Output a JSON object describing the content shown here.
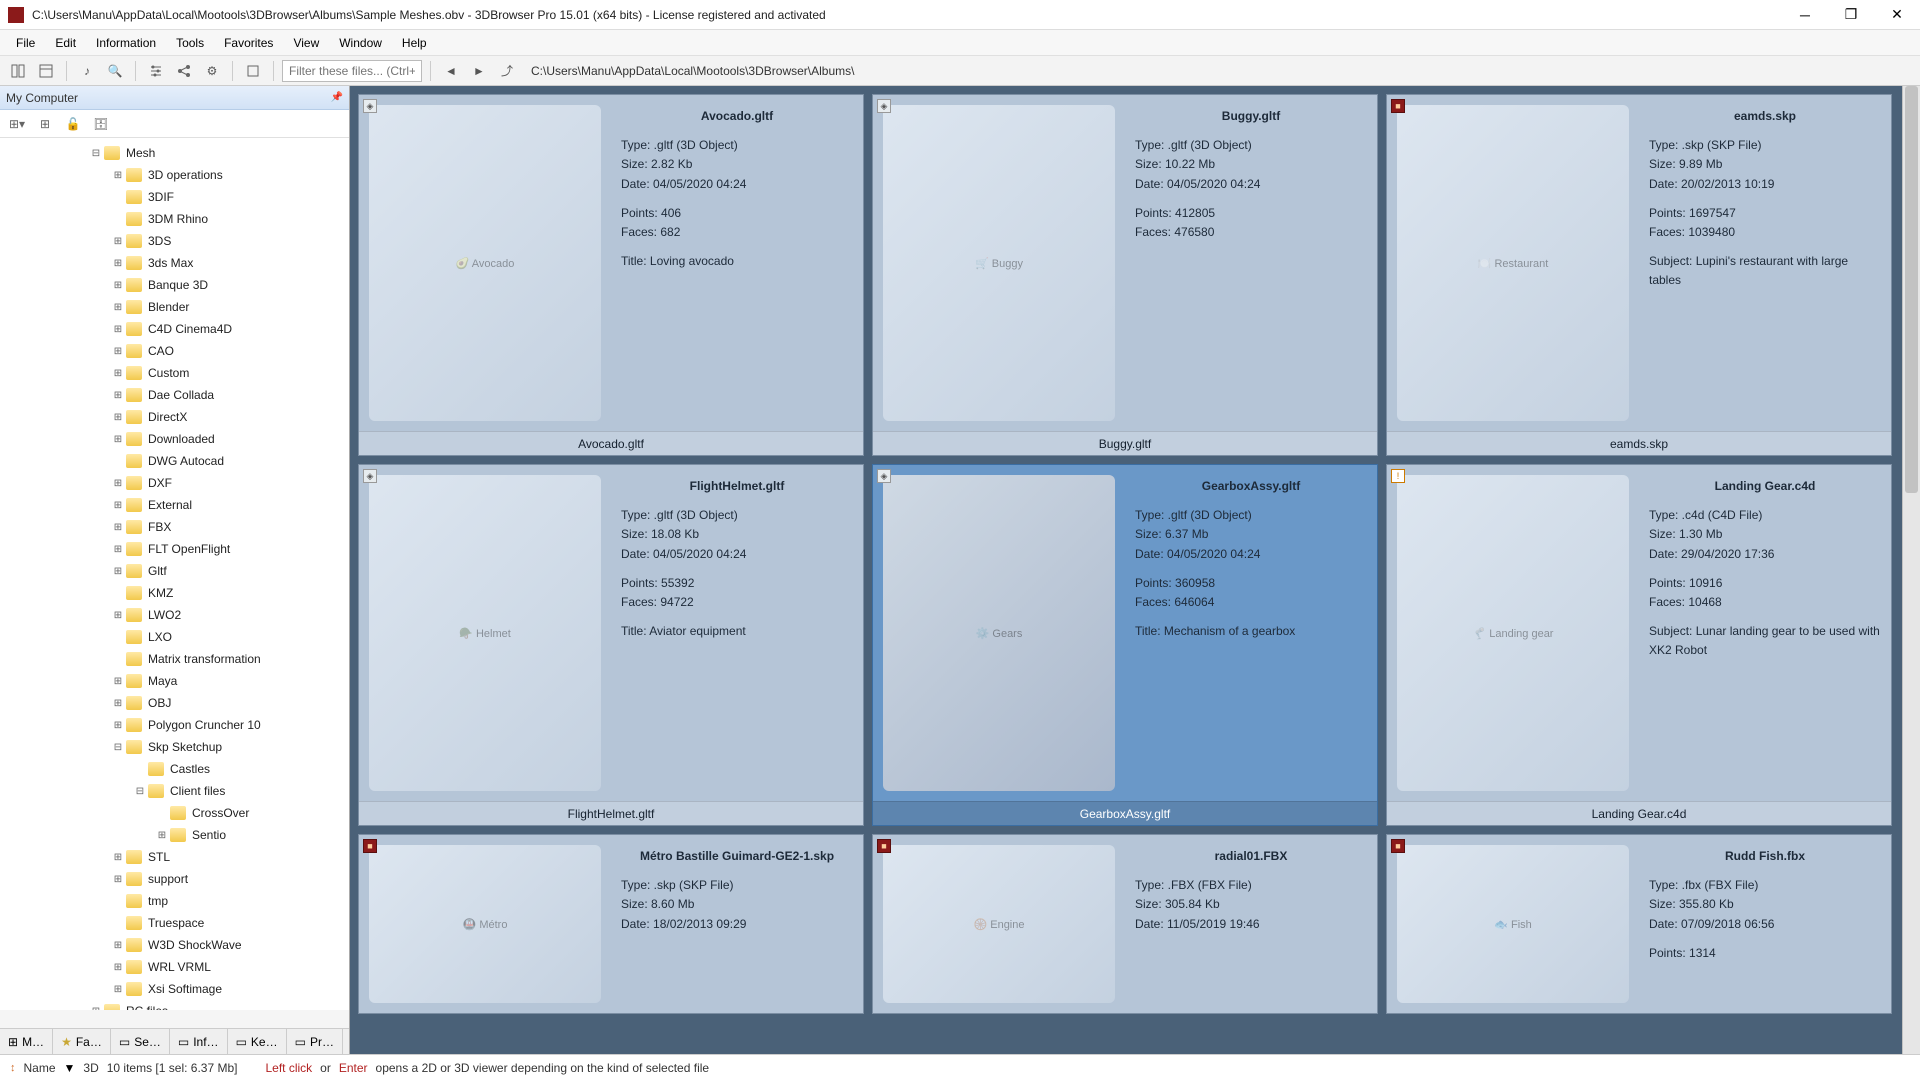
{
  "title": "C:\\Users\\Manu\\AppData\\Local\\Mootools\\3DBrowser\\Albums\\Sample Meshes.obv - 3DBrowser Pro 15.01 (x64 bits) - License registered  and activated",
  "menu": [
    "File",
    "Edit",
    "Information",
    "Tools",
    "Favorites",
    "View",
    "Window",
    "Help"
  ],
  "filter_placeholder": "Filter these files... (Ctrl+",
  "path": "C:\\Users\\Manu\\AppData\\Local\\Mootools\\3DBrowser\\Albums\\",
  "sidebar_title": "My Computer",
  "tree": [
    {
      "d": 0,
      "t": "⊟",
      "l": "Mesh"
    },
    {
      "d": 1,
      "t": "⊞",
      "l": "3D operations"
    },
    {
      "d": 1,
      "t": "",
      "l": "3DIF"
    },
    {
      "d": 1,
      "t": "",
      "l": "3DM Rhino"
    },
    {
      "d": 1,
      "t": "⊞",
      "l": "3DS"
    },
    {
      "d": 1,
      "t": "⊞",
      "l": "3ds Max"
    },
    {
      "d": 1,
      "t": "⊞",
      "l": "Banque 3D"
    },
    {
      "d": 1,
      "t": "⊞",
      "l": "Blender"
    },
    {
      "d": 1,
      "t": "⊞",
      "l": "C4D Cinema4D"
    },
    {
      "d": 1,
      "t": "⊞",
      "l": "CAO"
    },
    {
      "d": 1,
      "t": "⊞",
      "l": "Custom"
    },
    {
      "d": 1,
      "t": "⊞",
      "l": "Dae Collada"
    },
    {
      "d": 1,
      "t": "⊞",
      "l": "DirectX"
    },
    {
      "d": 1,
      "t": "⊞",
      "l": "Downloaded"
    },
    {
      "d": 1,
      "t": "",
      "l": "DWG Autocad"
    },
    {
      "d": 1,
      "t": "⊞",
      "l": "DXF"
    },
    {
      "d": 1,
      "t": "⊞",
      "l": "External"
    },
    {
      "d": 1,
      "t": "⊞",
      "l": "FBX"
    },
    {
      "d": 1,
      "t": "⊞",
      "l": "FLT OpenFlight"
    },
    {
      "d": 1,
      "t": "⊞",
      "l": "Gltf"
    },
    {
      "d": 1,
      "t": "",
      "l": "KMZ"
    },
    {
      "d": 1,
      "t": "⊞",
      "l": "LWO2"
    },
    {
      "d": 1,
      "t": "",
      "l": "LXO"
    },
    {
      "d": 1,
      "t": "",
      "l": "Matrix transformation"
    },
    {
      "d": 1,
      "t": "⊞",
      "l": "Maya"
    },
    {
      "d": 1,
      "t": "⊞",
      "l": "OBJ"
    },
    {
      "d": 1,
      "t": "⊞",
      "l": "Polygon Cruncher 10"
    },
    {
      "d": 1,
      "t": "⊟",
      "l": "Skp Sketchup"
    },
    {
      "d": 2,
      "t": "",
      "l": "Castles"
    },
    {
      "d": 2,
      "t": "⊟",
      "l": "Client files"
    },
    {
      "d": 3,
      "t": "",
      "l": "CrossOver"
    },
    {
      "d": 3,
      "t": "⊞",
      "l": "Sentio"
    },
    {
      "d": 1,
      "t": "⊞",
      "l": "STL"
    },
    {
      "d": 1,
      "t": "⊞",
      "l": "support"
    },
    {
      "d": 1,
      "t": "",
      "l": "tmp"
    },
    {
      "d": 1,
      "t": "",
      "l": "Truespace"
    },
    {
      "d": 1,
      "t": "⊞",
      "l": "W3D ShockWave"
    },
    {
      "d": 1,
      "t": "⊞",
      "l": "WRL VRML"
    },
    {
      "d": 1,
      "t": "⊞",
      "l": "Xsi Softimage"
    },
    {
      "d": 0,
      "t": "⊞",
      "l": "RC files"
    }
  ],
  "btabs": [
    "M…",
    "Fa…",
    "Se…",
    "Inf…",
    "Ke…",
    "Pr…"
  ],
  "items": [
    {
      "sel": false,
      "badge": "cube",
      "name": "Avocado.gltf",
      "type": "Type: .gltf (3D Object)",
      "size": "Size: 2.82 Kb",
      "date": "Date: 04/05/2020 04:24",
      "points": "Points: 406",
      "faces": "Faces: 682",
      "extra": "Title: Loving avocado",
      "thumb": "🥑 Avocado"
    },
    {
      "sel": false,
      "badge": "cube",
      "name": "Buggy.gltf",
      "type": "Type: .gltf (3D Object)",
      "size": "Size: 10.22 Mb",
      "date": "Date: 04/05/2020 04:24",
      "points": "Points: 412805",
      "faces": "Faces: 476580",
      "extra": "",
      "thumb": "🛒 Buggy"
    },
    {
      "sel": false,
      "badge": "red",
      "name": "eamds.skp",
      "type": "Type: .skp (SKP File)",
      "size": "Size: 9.89 Mb",
      "date": "Date: 20/02/2013 10:19",
      "points": "Points: 1697547",
      "faces": "Faces: 1039480",
      "extra": "Subject: Lupini's restaurant with large tables",
      "thumb": "🍽️ Restaurant"
    },
    {
      "sel": false,
      "badge": "cube",
      "name": "FlightHelmet.gltf",
      "type": "Type: .gltf (3D Object)",
      "size": "Size: 18.08 Kb",
      "date": "Date: 04/05/2020 04:24",
      "points": "Points: 55392",
      "faces": "Faces: 94722",
      "extra": "Title: Aviator equipment",
      "thumb": "🪖 Helmet"
    },
    {
      "sel": true,
      "badge": "cube",
      "name": "GearboxAssy.gltf",
      "type": "Type: .gltf (3D Object)",
      "size": "Size: 6.37 Mb",
      "date": "Date: 04/05/2020 04:24",
      "points": "Points: 360958",
      "faces": "Faces: 646064",
      "extra": "Title: Mechanism of a gearbox",
      "thumb": "⚙️ Gears"
    },
    {
      "sel": false,
      "badge": "amber",
      "name": "Landing Gear.c4d",
      "type": "Type: .c4d (C4D File)",
      "size": "Size: 1.30 Mb",
      "date": "Date: 29/04/2020 17:36",
      "points": "Points: 10916",
      "faces": "Faces: 10468",
      "extra": "Subject: Lunar landing gear to be used with XK2 Robot",
      "thumb": "🦿 Landing gear"
    },
    {
      "sel": false,
      "badge": "red",
      "name": "Métro Bastille Guimard-GE2-1.skp",
      "type": "Type: .skp (SKP File)",
      "size": "Size: 8.60 Mb",
      "date": "Date: 18/02/2013 09:29",
      "points": "",
      "faces": "",
      "extra": "",
      "thumb": "🚇 Métro"
    },
    {
      "sel": false,
      "badge": "red",
      "name": "radial01.FBX",
      "type": "Type: .FBX (FBX File)",
      "size": "Size: 305.84 Kb",
      "date": "Date: 11/05/2019 19:46",
      "points": "",
      "faces": "",
      "extra": "",
      "thumb": "🛞 Engine"
    },
    {
      "sel": false,
      "badge": "red",
      "name": "Rudd Fish.fbx",
      "type": "Type: .fbx (FBX File)",
      "size": "Size: 355.80 Kb",
      "date": "Date: 07/09/2018 06:56",
      "points": "Points: 1314",
      "faces": "",
      "extra": "",
      "thumb": "🐟 Fish"
    }
  ],
  "status": {
    "sort_label": "Name",
    "filter_label": "3D",
    "count": "10 items  [1 sel: 6.37 Mb]",
    "hint1": "Left click",
    "hint2": " or ",
    "hint3": "Enter",
    "hint4": " opens a 2D or 3D viewer depending on the kind of selected file"
  }
}
